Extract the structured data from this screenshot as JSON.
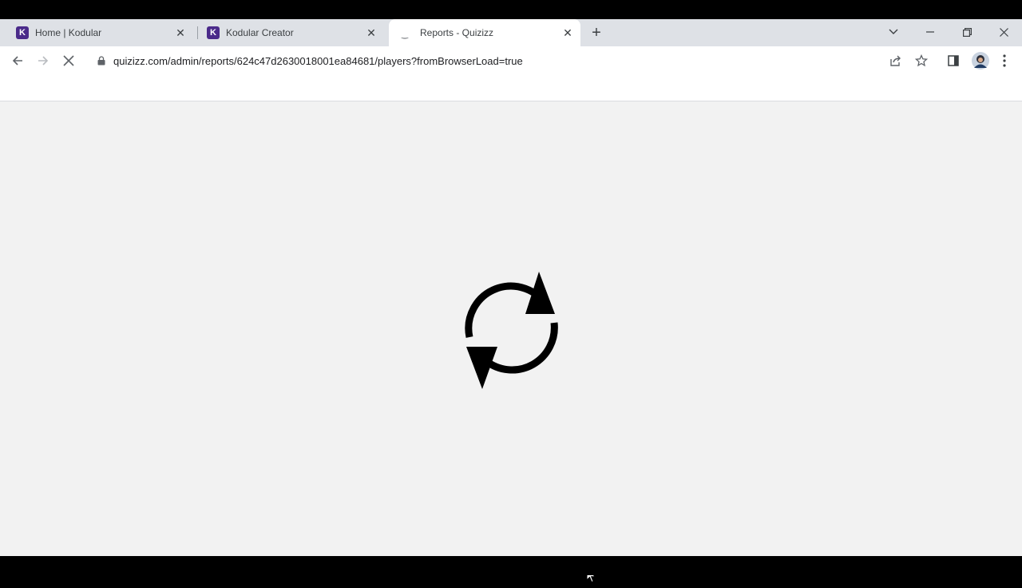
{
  "tabs": [
    {
      "title": "Home | Kodular",
      "favicon": "K"
    },
    {
      "title": "Kodular Creator",
      "favicon": "K"
    },
    {
      "title": "Reports - Quizizz",
      "favicon": "loading-spinner-icon"
    }
  ],
  "addressBar": {
    "url": "quizizz.com/admin/reports/624c47d2630018001ea84681/players?fromBrowserLoad=true"
  },
  "colors": {
    "tabStrip": "#dee1e6",
    "page": "#f2f2f2",
    "kodularFavicon": "#4a2a8a",
    "loaderIcon": "#000000"
  },
  "icons": [
    "back-icon",
    "forward-icon",
    "stop-loading-icon",
    "lock-icon",
    "share-icon",
    "star-icon",
    "side-panel-icon",
    "avatar",
    "menu-icon",
    "refresh-icon"
  ]
}
